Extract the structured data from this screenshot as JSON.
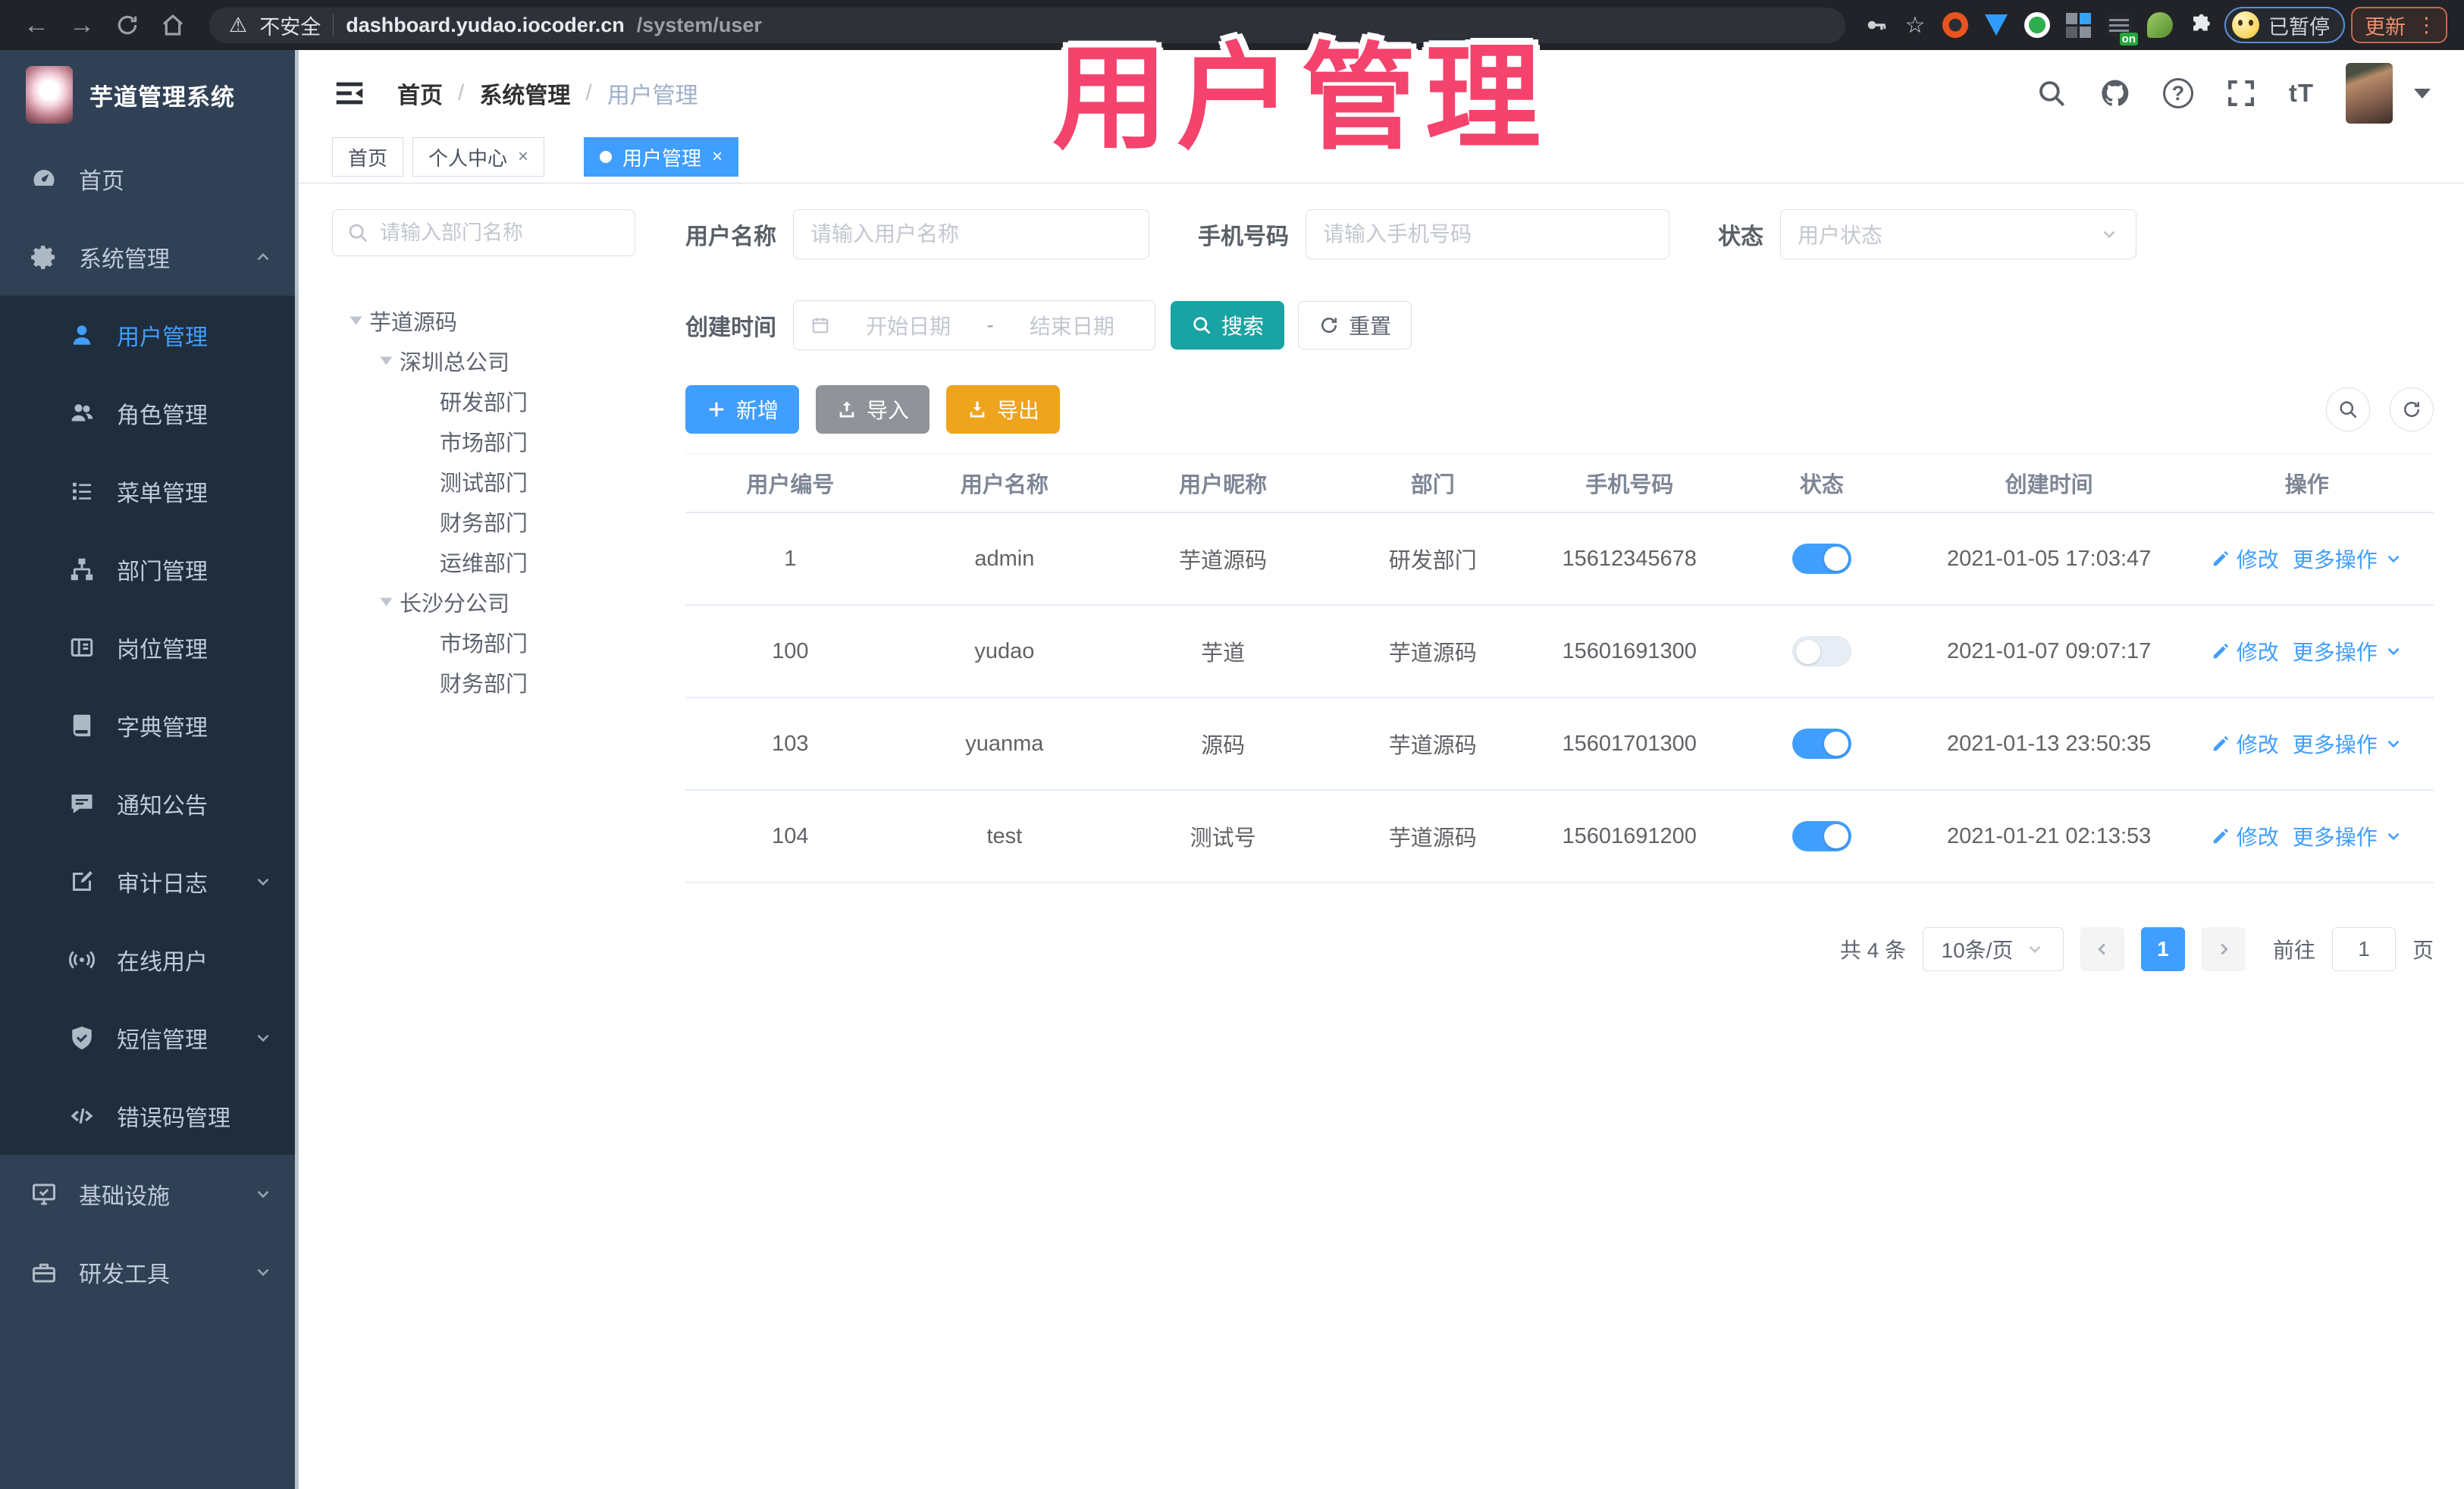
{
  "annotation": {
    "text": "用户管理",
    "color": "#f4436d"
  },
  "colors": {
    "accent": "#409eff",
    "search_teal": "#1aa3a3",
    "export_orange": "#efa41d",
    "import_gray": "#909399",
    "sidebar_bg": "#304156",
    "submenu_bg": "#1f2d3d",
    "annotation_pink": "#f4436d"
  },
  "browser": {
    "security_label": "不安全",
    "url_host": "dashboard.yudao.iocoder.cn",
    "url_path": "/system/user",
    "paused_badge": "已暂停",
    "update_label": "更新",
    "on_badge": "on",
    "glyphs": {
      "back": "←",
      "forward": "→",
      "star": "☆",
      "more_dots": "⋮",
      "warning": "⚠"
    }
  },
  "sidebar": {
    "title": "芋道管理系统",
    "items": [
      {
        "label": "首页"
      },
      {
        "label": "系统管理"
      },
      {
        "label": "用户管理"
      },
      {
        "label": "角色管理"
      },
      {
        "label": "菜单管理"
      },
      {
        "label": "部门管理"
      },
      {
        "label": "岗位管理"
      },
      {
        "label": "字典管理"
      },
      {
        "label": "通知公告"
      },
      {
        "label": "审计日志"
      },
      {
        "label": "在线用户"
      },
      {
        "label": "短信管理"
      },
      {
        "label": "错误码管理"
      },
      {
        "label": "基础设施"
      },
      {
        "label": "研发工具"
      }
    ]
  },
  "header": {
    "breadcrumb": [
      "首页",
      "系统管理",
      "用户管理"
    ],
    "glyphs": {
      "question": "?",
      "font_size": "tT"
    }
  },
  "tabs": [
    {
      "label": "首页"
    },
    {
      "label": "个人中心",
      "close": "×"
    },
    {
      "label": "用户管理",
      "close": "×"
    }
  ],
  "dept_panel": {
    "search_placeholder": "请输入部门名称",
    "tree": [
      {
        "label": "芋道源码"
      },
      {
        "label": "深圳总公司"
      },
      {
        "label": "研发部门"
      },
      {
        "label": "市场部门"
      },
      {
        "label": "测试部门"
      },
      {
        "label": "财务部门"
      },
      {
        "label": "运维部门"
      },
      {
        "label": "长沙分公司"
      },
      {
        "label": "市场部门"
      },
      {
        "label": "财务部门"
      }
    ]
  },
  "filters": {
    "name_label": "用户名称",
    "name_placeholder": "请输入用户名称",
    "phone_label": "手机号码",
    "phone_placeholder": "请输入手机号码",
    "status_label": "状态",
    "status_placeholder": "用户状态",
    "date_label": "创建时间",
    "date_start": "开始日期",
    "date_separator": "-",
    "date_end": "结束日期",
    "search_label": "搜索",
    "reset_label": "重置"
  },
  "toolbar": {
    "add": "新增",
    "import": "导入",
    "export": "导出"
  },
  "table": {
    "columns": [
      "用户编号",
      "用户名称",
      "用户昵称",
      "部门",
      "手机号码",
      "状态",
      "创建时间",
      "操作"
    ],
    "action_edit": "修改",
    "action_more": "更多操作",
    "rows": [
      {
        "id": "1",
        "username": "admin",
        "nickname": "芋道源码",
        "dept": "研发部门",
        "mobile": "15612345678",
        "status": true,
        "created": "2021-01-05 17:03:47"
      },
      {
        "id": "100",
        "username": "yudao",
        "nickname": "芋道",
        "dept": "芋道源码",
        "mobile": "15601691300",
        "status": false,
        "created": "2021-01-07 09:07:17"
      },
      {
        "id": "103",
        "username": "yuanma",
        "nickname": "源码",
        "dept": "芋道源码",
        "mobile": "15601701300",
        "status": true,
        "created": "2021-01-13 23:50:35"
      },
      {
        "id": "104",
        "username": "test",
        "nickname": "测试号",
        "dept": "芋道源码",
        "mobile": "15601691200",
        "status": true,
        "created": "2021-01-21 02:13:53"
      }
    ]
  },
  "pagination": {
    "total": "共 4 条",
    "page_size": "10条/页",
    "current_page": "1",
    "goto_label": "前往",
    "goto_value": "1",
    "page_unit": "页"
  }
}
